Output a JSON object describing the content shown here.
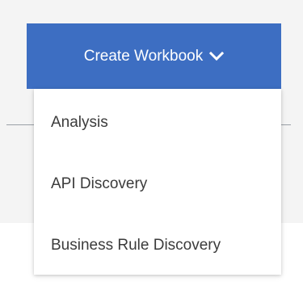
{
  "create_button": {
    "label": "Create Workbook",
    "icon": "chevron-down-icon",
    "color": "#3d6ec2"
  },
  "menu": {
    "items": [
      {
        "label": "Analysis"
      },
      {
        "label": "API Discovery"
      },
      {
        "label": "Business Rule Discovery"
      }
    ]
  }
}
